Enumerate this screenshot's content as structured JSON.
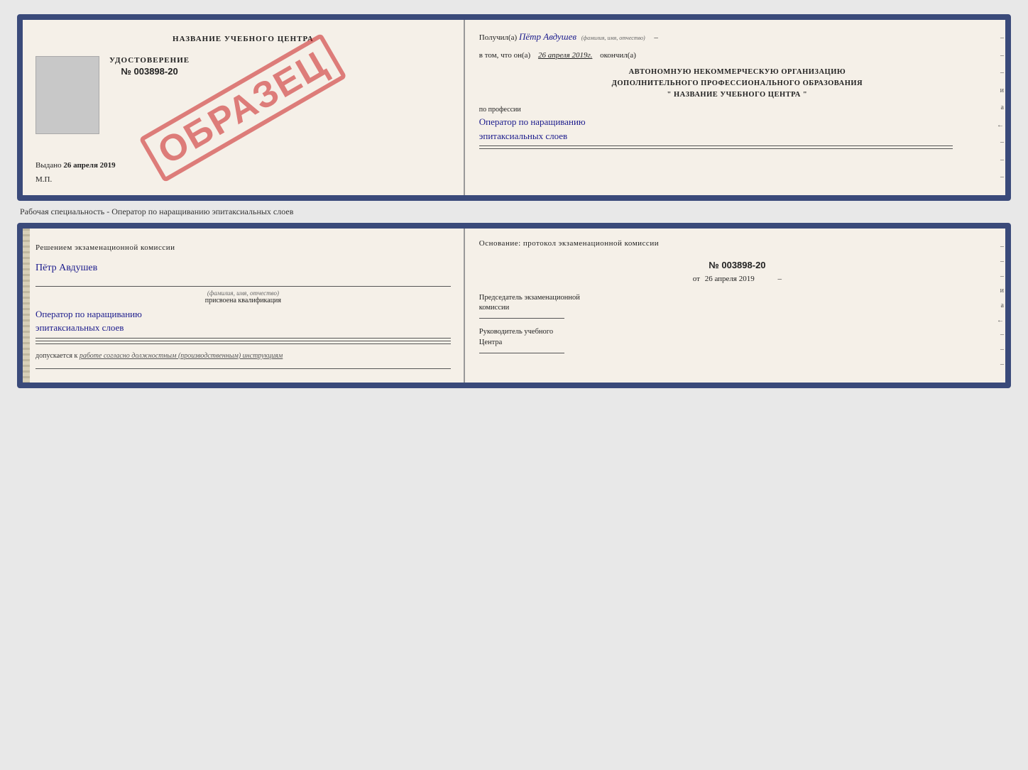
{
  "cert1": {
    "left": {
      "title": "НАЗВАНИЕ УЧЕБНОГО ЦЕНТРА",
      "doc_label": "УДОСТОВЕРЕНИЕ",
      "doc_number": "№ 003898-20",
      "issued_prefix": "Выдано",
      "issued_date": "26 апреля 2019",
      "mp_label": "М.П.",
      "stamp_text": "ОБРАЗЕЦ"
    },
    "right": {
      "received_prefix": "Получил(а)",
      "received_name": "Пётр Авдушев",
      "fio_label": "(фамилия, имя, отчество)",
      "date_prefix": "в том, что он(а)",
      "date_value": "26 апреля 2019г.",
      "date_suffix": "окончил(а)",
      "org_line1": "АВТОНОМНУЮ НЕКОММЕРЧЕСКУЮ ОРГАНИЗАЦИЮ",
      "org_line2": "ДОПОЛНИТЕЛЬНОГО ПРОФЕССИОНАЛЬНОГО ОБРАЗОВАНИЯ",
      "org_line3": "\"  НАЗВАНИЕ УЧЕБНОГО ЦЕНТРА  \"",
      "profession_label": "по профессии",
      "profession_value1": "Оператор по наращиванию",
      "profession_value2": "эпитаксиальных слоев"
    },
    "right_margin": [
      "-",
      "-",
      "-",
      "и",
      "ıа",
      "←",
      "-",
      "-",
      "-"
    ]
  },
  "separator": {
    "text": "Рабочая специальность - Оператор по наращиванию эпитаксиальных слоев"
  },
  "cert2": {
    "left": {
      "komissia_title": "Решением  экзаменационной  комиссии",
      "person_name": "Пётр Авдушев",
      "fio_label": "(фамилия, имя, отчество)",
      "qualification_label": "присвоена квалификация",
      "qualification_value1": "Оператор по наращиванию",
      "qualification_value2": "эпитаксиальных слоев",
      "dopusk_prefix": "допускается к",
      "dopusk_value": "работе согласно должностным (производственным) инструкциям"
    },
    "right": {
      "osnov_title": "Основание: протокол экзаменационной  комиссии",
      "number": "№  003898-20",
      "date_prefix": "от",
      "date_value": "26 апреля 2019",
      "predsedatel_line1": "Председатель экзаменационной",
      "predsedatel_line2": "комиссии",
      "rukov_line1": "Руководитель учебного",
      "rukov_line2": "Центра"
    },
    "right_margin": [
      "-",
      "-",
      "-",
      "и",
      "ıа",
      "←",
      "-",
      "-",
      "-"
    ]
  }
}
